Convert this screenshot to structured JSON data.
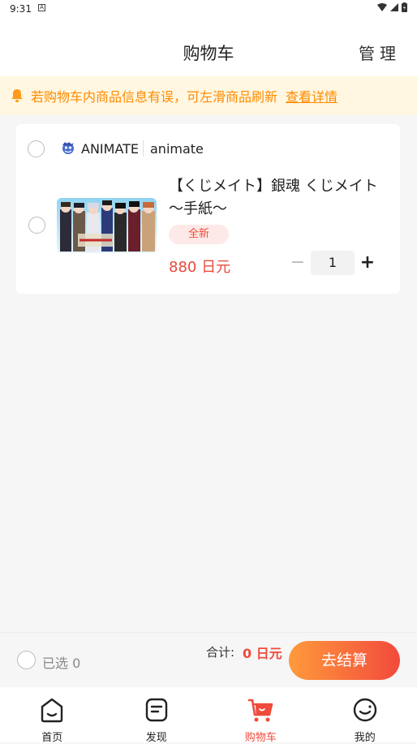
{
  "status_bar": {
    "time": "9:31",
    "notification_glyph": "A"
  },
  "header": {
    "title": "购物车",
    "manage_label": "管理"
  },
  "notice": {
    "text": "若购物车内商品信息有误，可左滑商品刷新",
    "link_label": "查看详情"
  },
  "shop": {
    "name": "ANIMATE",
    "sub_name": "animate"
  },
  "item": {
    "title": "【くじメイト】銀魂 くじメイト～手紙～",
    "condition_badge": "全新",
    "price": "880 日元",
    "quantity": "1",
    "thumbnail_alt": "product thumbnail"
  },
  "checkout": {
    "selected_label": "已选 0",
    "total_label": "合计:",
    "total_value": "0 日元",
    "pay_button": "去结算"
  },
  "tabs": [
    {
      "label": "首页",
      "icon": "home-icon",
      "active": false
    },
    {
      "label": "发现",
      "icon": "discover-icon",
      "active": false
    },
    {
      "label": "购物车",
      "icon": "cart-icon",
      "active": true
    },
    {
      "label": "我的",
      "icon": "profile-icon",
      "active": false
    }
  ],
  "colors": {
    "accent": "#f04a3c",
    "notice_bg": "#fff7e1",
    "notice_text": "#ff8a00",
    "button_gradient_start": "#ff9a3c",
    "button_gradient_end": "#f24a3c"
  }
}
